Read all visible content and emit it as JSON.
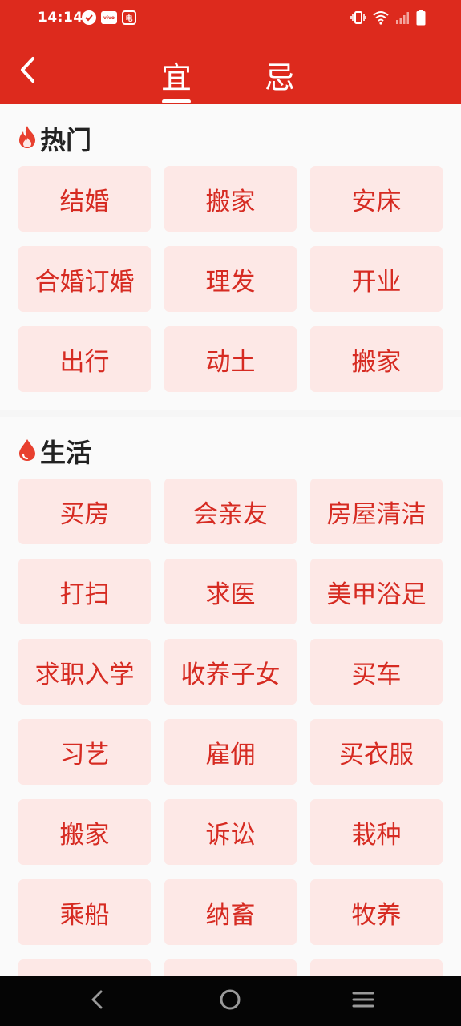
{
  "status_bar": {
    "time": "14:14",
    "vivo_badge": "vivo",
    "app_badge": "电",
    "icons": [
      "check-circle-icon",
      "vivo-icon",
      "app-notification-icon",
      "vibrate-icon",
      "wifi-icon",
      "signal-icon",
      "battery-icon"
    ]
  },
  "header": {
    "back_icon": "chevron-left-icon",
    "tabs": [
      {
        "label": "宜",
        "active": true
      },
      {
        "label": "忌",
        "active": false
      }
    ],
    "background_color": "#dd2a1d"
  },
  "sections": {
    "hot": {
      "title": "热门",
      "icon": "flame-icon",
      "items": [
        "结婚",
        "搬家",
        "安床",
        "合婚订婚",
        "理发",
        "开业",
        "出行",
        "动土",
        "搬家"
      ]
    },
    "life": {
      "title": "生活",
      "icon": "drop-icon",
      "items": [
        "买房",
        "会亲友",
        "房屋清洁",
        "打扫",
        "求医",
        "美甲浴足",
        "求职入学",
        "收养子女",
        "买车",
        "习艺",
        "雇佣",
        "买衣服",
        "搬家",
        "诉讼",
        "栽种",
        "乘船",
        "纳畜",
        "牧养",
        "",
        "",
        ""
      ]
    }
  },
  "colors": {
    "accent": "#dd2a1d",
    "cell_bg": "#fde8e6",
    "cell_text": "#d62b22"
  },
  "nav_bar": {
    "buttons": [
      "back-icon",
      "home-icon",
      "menu-icon"
    ]
  }
}
